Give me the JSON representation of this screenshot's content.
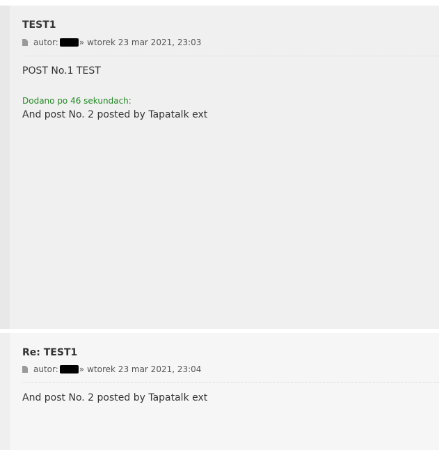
{
  "posts": [
    {
      "title": "TEST1",
      "author_prefix": "autor:",
      "separator": "»",
      "date": "wtorek 23 mar 2021, 23:03",
      "content_line": "POST No.1 TEST",
      "added_note": "Dodano po 46 sekundach:",
      "added_content": "And post No. 2 posted by Tapatalk ext"
    },
    {
      "title": "Re: TEST1",
      "author_prefix": "autor:",
      "separator": "»",
      "date": "wtorek 23 mar 2021, 23:04",
      "content_line": "And post No. 2 posted by Tapatalk ext"
    }
  ],
  "icons": {
    "post_icon": "document-icon"
  },
  "colors": {
    "added_note": "#228822",
    "post1_bg": "#f0f0f0",
    "post2_bg": "#f6f6f6"
  }
}
